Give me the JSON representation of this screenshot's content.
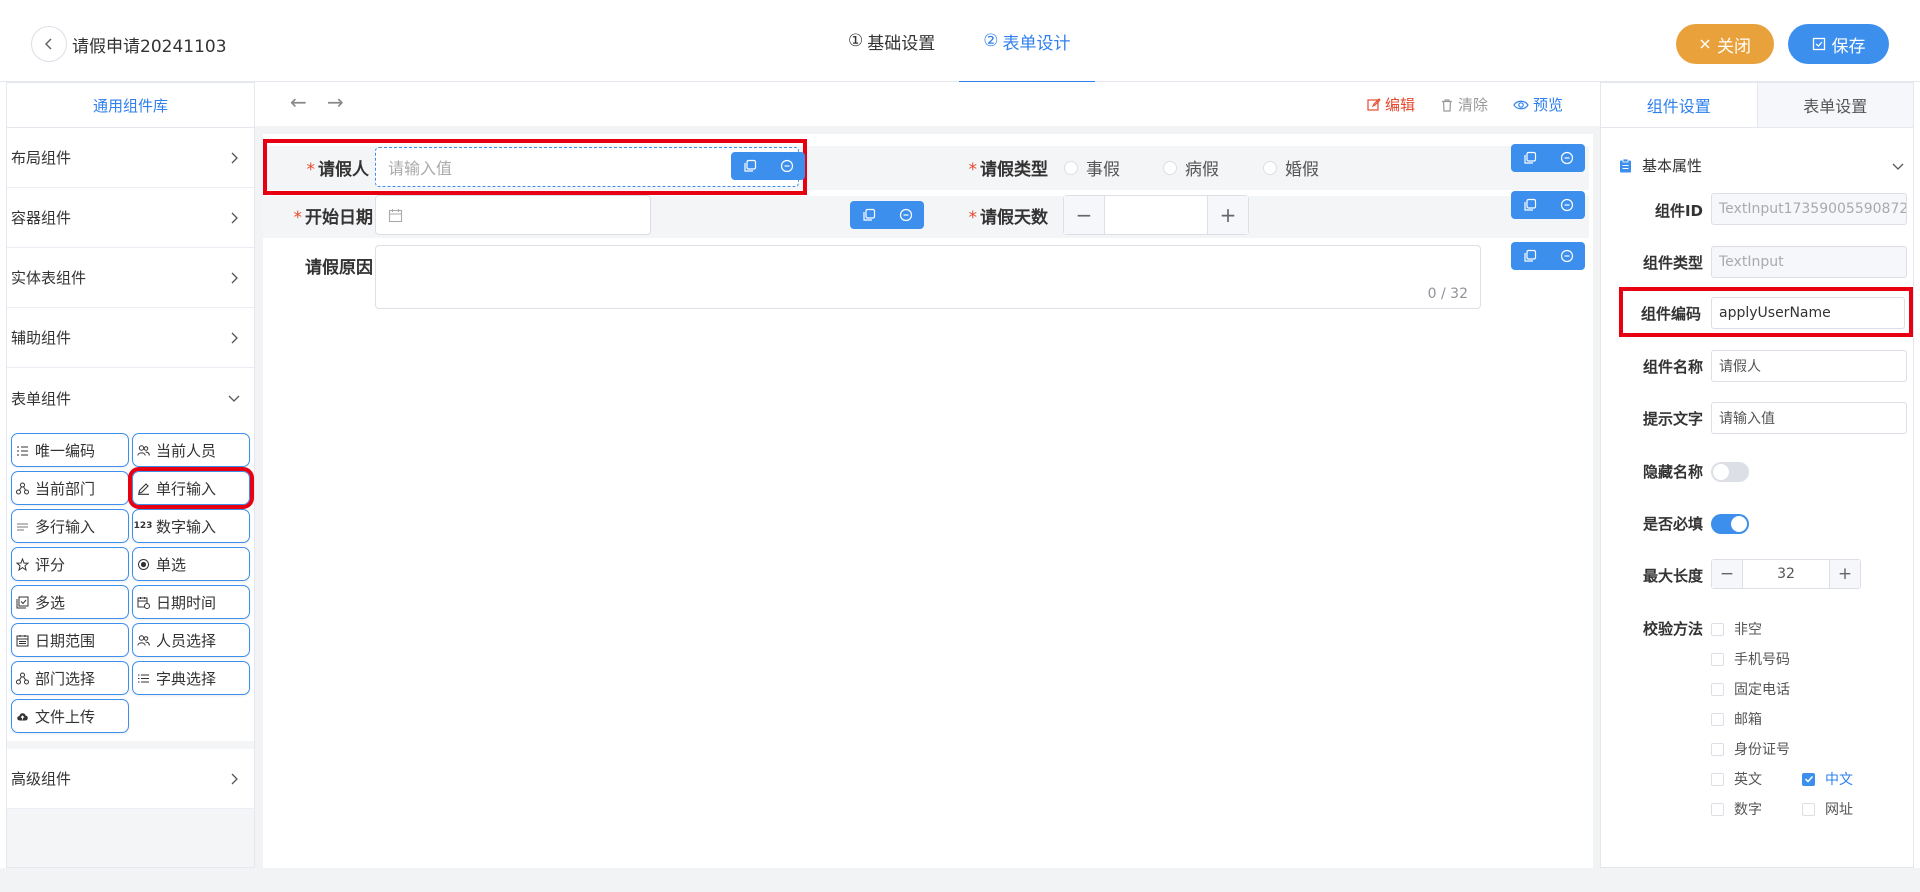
{
  "header": {
    "title": "请假申请20241103",
    "steps": [
      {
        "num": "①",
        "label": "基础设置"
      },
      {
        "num": "②",
        "label": "表单设计"
      }
    ],
    "close_label": "关闭",
    "save_label": "保存"
  },
  "left": {
    "tab": "通用组件库",
    "categories": [
      "布局组件",
      "容器组件",
      "实体表组件",
      "辅助组件",
      "表单组件",
      "高级组件"
    ],
    "components": [
      {
        "label": "唯一编码",
        "icon": "list-numbered-icon"
      },
      {
        "label": "当前人员",
        "icon": "users-icon"
      },
      {
        "label": "当前部门",
        "icon": "org-icon"
      },
      {
        "label": "单行输入",
        "icon": "edit-icon"
      },
      {
        "label": "多行输入",
        "icon": "multiline-icon"
      },
      {
        "label": "数字输入",
        "icon": "number-icon"
      },
      {
        "label": "评分",
        "icon": "star-icon"
      },
      {
        "label": "单选",
        "icon": "radio-icon"
      },
      {
        "label": "多选",
        "icon": "checkbox-icon"
      },
      {
        "label": "日期时间",
        "icon": "datetime-icon"
      },
      {
        "label": "日期范围",
        "icon": "calendar-icon"
      },
      {
        "label": "人员选择",
        "icon": "users-icon"
      },
      {
        "label": "部门选择",
        "icon": "org-icon"
      },
      {
        "label": "字典选择",
        "icon": "list-icon"
      },
      {
        "label": "文件上传",
        "icon": "upload-icon"
      }
    ]
  },
  "toolbar": {
    "edit": "编辑",
    "clear": "清除",
    "preview": "预览"
  },
  "form": {
    "applicant_label": "请假人",
    "applicant_placeholder": "请输入值",
    "leave_type_label": "请假类型",
    "leave_type_options": [
      "事假",
      "病假",
      "婚假"
    ],
    "start_date_label": "开始日期",
    "days_label": "请假天数",
    "reason_label": "请假原因",
    "reason_count": "0 / 32"
  },
  "right": {
    "tabs": [
      "组件设置",
      "表单设置"
    ],
    "section": "基本属性",
    "props": {
      "id_label": "组件ID",
      "id_value": "TextInput17359005590872",
      "type_label": "组件类型",
      "type_value": "TextInput",
      "code_label": "组件编码",
      "code_value": "applyUserName",
      "name_label": "组件名称",
      "name_value": "请假人",
      "hint_label": "提示文字",
      "hint_value": "请输入值",
      "hide_label": "隐藏名称",
      "required_label": "是否必填",
      "maxlen_label": "最大长度",
      "maxlen_value": "32",
      "validate_label": "校验方法"
    },
    "validations": [
      {
        "label": "非空",
        "checked": false
      },
      {
        "label": "手机号码",
        "checked": false
      },
      {
        "label": "固定电话",
        "checked": false
      },
      {
        "label": "邮箱",
        "checked": false
      },
      {
        "label": "身份证号",
        "checked": false
      },
      {
        "label": "英文",
        "checked": false
      },
      {
        "label": "中文",
        "checked": true
      },
      {
        "label": "数字",
        "checked": false
      },
      {
        "label": "网址",
        "checked": false
      }
    ],
    "hide_name": false,
    "required": true
  },
  "colors": {
    "primary": "#3d8fed",
    "warning": "#e9a23b",
    "highlight": "#e60012",
    "required_mark": "#e6492d"
  }
}
